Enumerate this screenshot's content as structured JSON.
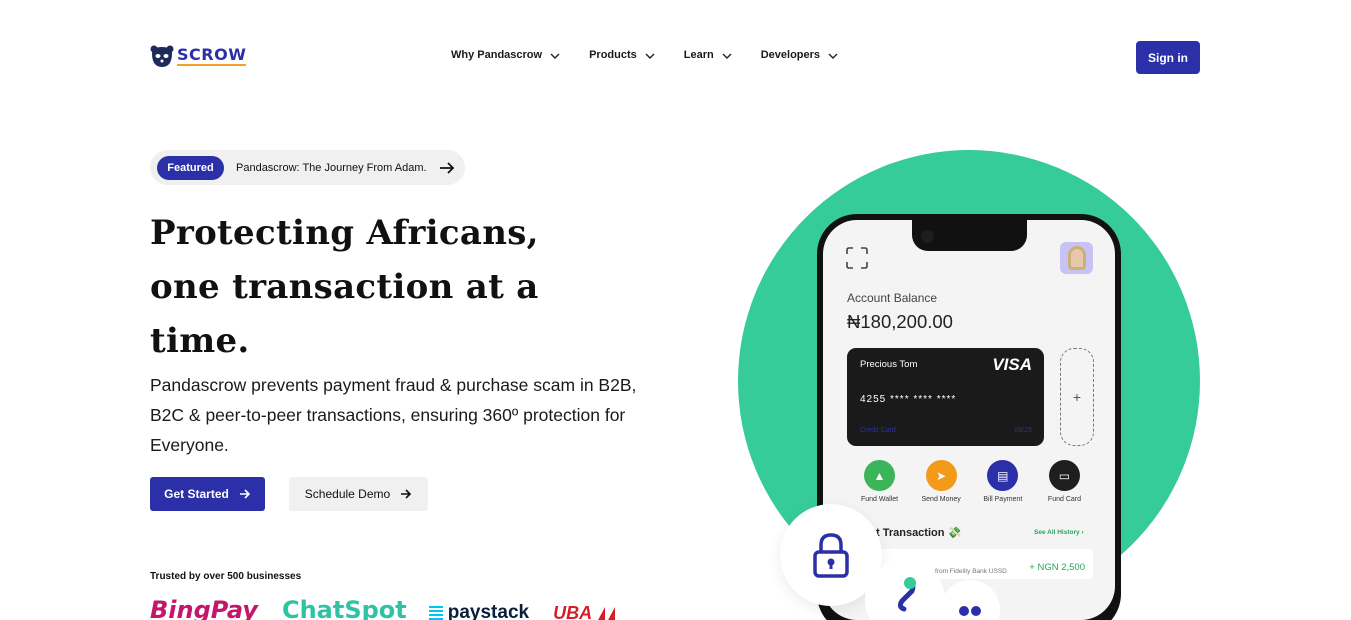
{
  "nav": {
    "logo_text": "SCROW",
    "menu": [
      {
        "label": "Why Pandascrow"
      },
      {
        "label": "Products"
      },
      {
        "label": "Learn"
      },
      {
        "label": "Developers"
      }
    ],
    "signin_label": "Sign in"
  },
  "hero": {
    "featured_tag": "Featured",
    "featured_text": "Pandascrow: The Journey From Adam.",
    "headline": [
      "Protecting Africans,",
      "one transaction at a",
      "time."
    ],
    "subtext": "Pandascrow prevents payment fraud & purchase scam in B2B, B2C & peer-to-peer transactions, ensuring 360º protection for Everyone.",
    "get_started_label": "Get Started",
    "schedule_demo_label": "Schedule Demo",
    "trusted_text": "Trusted by over 500 businesses",
    "brands": [
      "BingPay",
      "ChatSpot",
      "paystack",
      "UBA"
    ]
  },
  "phone": {
    "balance_label": "Account Balance",
    "balance_value": "₦180,200.00",
    "card": {
      "holder": "Precious Tom",
      "network": "VISA",
      "number": "4255   ****   ****   ****",
      "type": "Credit Card",
      "expiry": "09/25"
    },
    "add_card_symbol": "+",
    "actions": [
      {
        "label": "Fund Wallet",
        "color": "#3cb55a"
      },
      {
        "label": "Send Money",
        "color": "#f49a1a"
      },
      {
        "label": "Bill Payment",
        "color": "#2b2fa8"
      },
      {
        "label": "Fund Card",
        "color": "#1e1e1e"
      }
    ],
    "recent_title": "t Transaction 💸",
    "see_all": "See All History  ›",
    "txn": {
      "description": "from Fidelity Bank USSD",
      "amount": "+ NGN 2,500"
    }
  },
  "colors": {
    "brand": "#2b2fa8",
    "accent_green": "#36cc99"
  }
}
